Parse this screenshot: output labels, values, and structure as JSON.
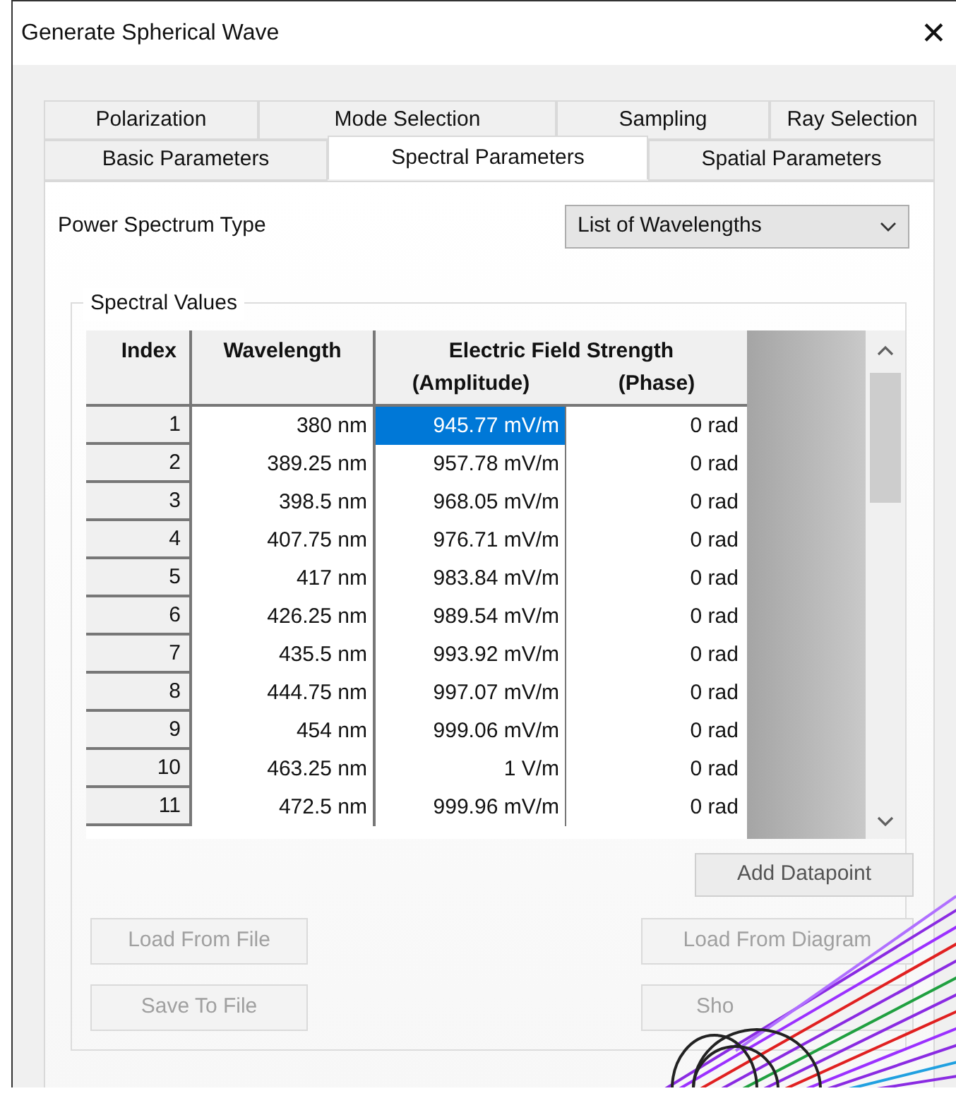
{
  "window": {
    "title": "Generate Spherical Wave",
    "close": "✕"
  },
  "tab_rows": [
    [
      {
        "label": "Polarization",
        "selected": false
      },
      {
        "label": "Mode Selection",
        "selected": false
      },
      {
        "label": "Sampling",
        "selected": false
      },
      {
        "label": "Ray Selection",
        "selected": false
      }
    ],
    [
      {
        "label": "Basic Parameters",
        "selected": false
      },
      {
        "label": "Spectral Parameters",
        "selected": true
      },
      {
        "label": "Spatial Parameters",
        "selected": false
      }
    ]
  ],
  "power_spectrum": {
    "label": "Power Spectrum Type",
    "value": "List of Wavelengths"
  },
  "group": {
    "title": "Spectral Values"
  },
  "table": {
    "columns": [
      {
        "label": "Index"
      },
      {
        "label": "Wavelength"
      },
      {
        "label": "Electric Field Strength",
        "sub": [
          "(Amplitude)",
          "(Phase)"
        ]
      }
    ],
    "rows": [
      {
        "index": "1",
        "wavelength": "380 nm",
        "amplitude": "945.77 mV/m",
        "phase": "0 rad",
        "selected": true
      },
      {
        "index": "2",
        "wavelength": "389.25 nm",
        "amplitude": "957.78 mV/m",
        "phase": "0 rad",
        "selected": false
      },
      {
        "index": "3",
        "wavelength": "398.5 nm",
        "amplitude": "968.05 mV/m",
        "phase": "0 rad",
        "selected": false
      },
      {
        "index": "4",
        "wavelength": "407.75 nm",
        "amplitude": "976.71 mV/m",
        "phase": "0 rad",
        "selected": false
      },
      {
        "index": "5",
        "wavelength": "417 nm",
        "amplitude": "983.84 mV/m",
        "phase": "0 rad",
        "selected": false
      },
      {
        "index": "6",
        "wavelength": "426.25 nm",
        "amplitude": "989.54 mV/m",
        "phase": "0 rad",
        "selected": false
      },
      {
        "index": "7",
        "wavelength": "435.5 nm",
        "amplitude": "993.92 mV/m",
        "phase": "0 rad",
        "selected": false
      },
      {
        "index": "8",
        "wavelength": "444.75 nm",
        "amplitude": "997.07 mV/m",
        "phase": "0 rad",
        "selected": false
      },
      {
        "index": "9",
        "wavelength": "454 nm",
        "amplitude": "999.06 mV/m",
        "phase": "0 rad",
        "selected": false
      },
      {
        "index": "10",
        "wavelength": "463.25 nm",
        "amplitude": "1 V/m",
        "phase": "0 rad",
        "selected": false
      },
      {
        "index": "11",
        "wavelength": "472.5 nm",
        "amplitude": "999.96 mV/m",
        "phase": "0 rad",
        "selected": false
      }
    ]
  },
  "buttons": {
    "add": {
      "label": "Add Datapoint",
      "disabled": false
    },
    "left": [
      {
        "label": "Load From File",
        "disabled": true
      },
      {
        "label": "Save To File",
        "disabled": true
      }
    ],
    "right": [
      {
        "label": "Load From Diagram",
        "disabled": true
      },
      {
        "label": "Sho",
        "disabled": true
      }
    ]
  }
}
